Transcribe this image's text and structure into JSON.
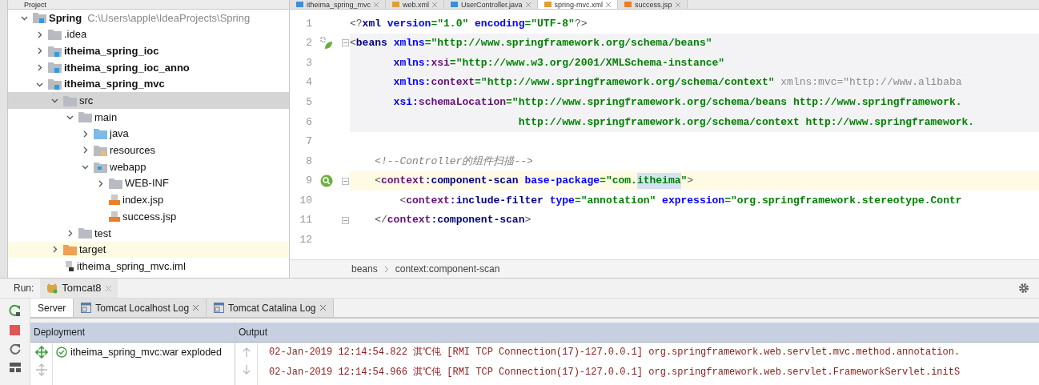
{
  "project": {
    "title": "Project",
    "tree": [
      {
        "name": "Spring",
        "kind": "project",
        "path": "C:\\Users\\apple\\IdeaProjects\\Spring",
        "expanded": true,
        "selected": false,
        "children": [
          {
            "name": ".idea",
            "kind": "folder",
            "expanded": false,
            "selected": false
          },
          {
            "name": "itheima_spring_ioc",
            "kind": "module",
            "expanded": false,
            "selected": false
          },
          {
            "name": "itheima_spring_ioc_anno",
            "kind": "module",
            "expanded": false,
            "selected": false
          },
          {
            "name": "itheima_spring_mvc",
            "kind": "module",
            "expanded": true,
            "selected": false,
            "children": [
              {
                "name": "src",
                "kind": "folder",
                "expanded": true,
                "selected": true,
                "children": [
                  {
                    "name": "main",
                    "kind": "folder",
                    "expanded": true,
                    "selected": false,
                    "children": [
                      {
                        "name": "java",
                        "kind": "source",
                        "expanded": false,
                        "selected": false
                      },
                      {
                        "name": "resources",
                        "kind": "resources",
                        "expanded": false,
                        "selected": false
                      },
                      {
                        "name": "webapp",
                        "kind": "webapp",
                        "expanded": true,
                        "selected": false,
                        "children": [
                          {
                            "name": "WEB-INF",
                            "kind": "folder",
                            "expanded": false,
                            "selected": false
                          },
                          {
                            "name": "index.jsp",
                            "kind": "jsp",
                            "selected": false
                          },
                          {
                            "name": "success.jsp",
                            "kind": "jsp",
                            "selected": false
                          }
                        ]
                      }
                    ]
                  },
                  {
                    "name": "test",
                    "kind": "folder",
                    "expanded": false,
                    "selected": false
                  }
                ]
              },
              {
                "name": "target",
                "kind": "target",
                "expanded": false,
                "selected": false,
                "highlighted": true
              },
              {
                "name": "itheima_spring_mvc.iml",
                "kind": "iml",
                "selected": false
              }
            ]
          }
        ]
      }
    ]
  },
  "editor_tabs": [
    {
      "label": "itheima_spring_mvc",
      "kind": "module",
      "selected": false
    },
    {
      "label": "web.xml",
      "kind": "xml",
      "selected": false
    },
    {
      "label": "UserController.java",
      "kind": "java",
      "selected": false
    },
    {
      "label": "spring-mvc.xml",
      "kind": "xml",
      "selected": true
    },
    {
      "label": "success.jsp",
      "kind": "jsp",
      "selected": false
    }
  ],
  "code_lines": [
    {
      "number": "1",
      "current": false,
      "block": false,
      "segments": [
        {
          "text": "<?",
          "kind": "punct"
        },
        {
          "text": "xml",
          "kind": "tag"
        },
        {
          "text": " version",
          "kind": "attr"
        },
        {
          "text": "=\"1.0\"",
          "kind": "value"
        },
        {
          "text": " encoding",
          "kind": "attr"
        },
        {
          "text": "=\"UTF-8\"",
          "kind": "value"
        },
        {
          "text": "?>",
          "kind": "punct"
        }
      ]
    },
    {
      "number": "2",
      "current": false,
      "block": true,
      "kind": "bean",
      "fold": true,
      "segments": [
        {
          "text": "<",
          "kind": "punct"
        },
        {
          "text": "beans",
          "kind": "tag"
        },
        {
          "text": " xmlns",
          "kind": "attr"
        },
        {
          "text": "=\"http://www.springframework.org/schema/beans\"",
          "kind": "value"
        }
      ]
    },
    {
      "number": "3",
      "current": false,
      "block": true,
      "segments": [
        {
          "text": "       xmlns:",
          "kind": "attr"
        },
        {
          "text": "xsi",
          "kind": "ns"
        },
        {
          "text": "=\"http://www.w3.org/2001/XMLSchema-instance\"",
          "kind": "value"
        }
      ]
    },
    {
      "number": "4",
      "current": false,
      "block": true,
      "segments": [
        {
          "text": "       xmlns:",
          "kind": "attr"
        },
        {
          "text": "context",
          "kind": "ns"
        },
        {
          "text": "=\"http://www.springframework.org/schema/context\"",
          "kind": "value"
        },
        {
          "text": " xmlns:mvc=\"http://www.alibaba",
          "kind": "dim"
        }
      ]
    },
    {
      "number": "5",
      "current": false,
      "block": true,
      "segments": [
        {
          "text": "       xsi:",
          "kind": "attr"
        },
        {
          "text": "schemaLocation",
          "kind": "ns"
        },
        {
          "text": "=\"http://www.springframework.org/schema/beans http://www.springframework.",
          "kind": "value"
        }
      ]
    },
    {
      "number": "6",
      "current": false,
      "block": true,
      "segments": [
        {
          "text": "                           http://www.springframework.org/schema/context http://www.springframework.",
          "kind": "value"
        }
      ]
    },
    {
      "number": "7",
      "current": false,
      "block": false
    },
    {
      "number": "8",
      "current": false,
      "block": false,
      "segments": [
        {
          "text": "    <!--Controller的组件扫描-->",
          "kind": "comment"
        }
      ]
    },
    {
      "number": "9",
      "current": true,
      "block": false,
      "kind": "scan",
      "fold": true,
      "segments": [
        {
          "text": "    <",
          "kind": "punct"
        },
        {
          "text": "context",
          "kind": "ns"
        },
        {
          "text": ":component-scan",
          "kind": "tag"
        },
        {
          "text": " base-package",
          "kind": "attr"
        },
        {
          "text": "=\"com.",
          "kind": "value"
        },
        {
          "text": "itheima",
          "kind": "found"
        },
        {
          "text": "\"",
          "kind": "value"
        },
        {
          "text": ">",
          "kind": "punct"
        }
      ]
    },
    {
      "number": "10",
      "current": false,
      "block": false,
      "segments": [
        {
          "text": "        <",
          "kind": "punct"
        },
        {
          "text": "context",
          "kind": "ns"
        },
        {
          "text": ":include-filter",
          "kind": "tag"
        },
        {
          "text": " type",
          "kind": "attr"
        },
        {
          "text": "=\"annotation\"",
          "kind": "value"
        },
        {
          "text": " expression",
          "kind": "attr"
        },
        {
          "text": "=\"org.springframework.stereotype.Contr",
          "kind": "value"
        }
      ]
    },
    {
      "number": "11",
      "current": false,
      "block": false,
      "fold": true,
      "segments": [
        {
          "text": "    </",
          "kind": "punct"
        },
        {
          "text": "context",
          "kind": "ns"
        },
        {
          "text": ":component-scan",
          "kind": "tag"
        },
        {
          "text": ">",
          "kind": "punct"
        }
      ]
    },
    {
      "number": "12",
      "current": false,
      "block": false
    }
  ],
  "breadcrumbs": [
    "beans",
    "context:component-scan"
  ],
  "run": {
    "label": "Run:",
    "tab": "Tomcat8",
    "subtabs": [
      {
        "label": "Server",
        "kind": "plain",
        "selected": true
      },
      {
        "label": "Tomcat Localhost Log",
        "kind": "log",
        "selected": false
      },
      {
        "label": "Tomcat Catalina Log",
        "kind": "log",
        "selected": false
      }
    ],
    "columns": [
      "Deployment",
      "Output"
    ],
    "deployments": [
      {
        "name": "itheima_spring_mvc:war exploded",
        "deployed": true
      }
    ],
    "output": [
      "02-Jan-2019 12:14:54.822 淇℃伅 [RMI TCP Connection(17)-127.0.0.1] org.springframework.web.servlet.mvc.method.annotation.",
      "02-Jan-2019 12:14:54.966 淇℃伅 [RMI TCP Connection(17)-127.0.0.1] org.springframework.web.servlet.FrameworkServlet.initS"
    ]
  }
}
